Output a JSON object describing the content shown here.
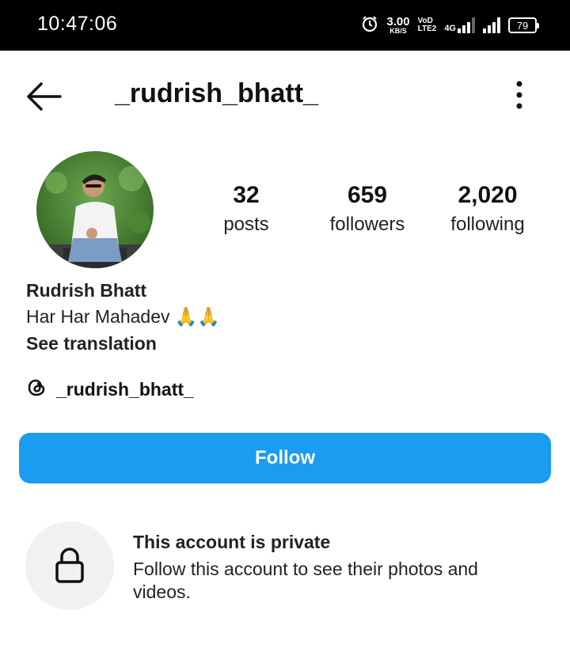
{
  "status_bar": {
    "time": "10:47:06",
    "speed_value": "3.00",
    "speed_unit": "KB/S",
    "volte_top": "VoD",
    "volte_bottom": "LTE2",
    "network": "4G",
    "battery": "79"
  },
  "header": {
    "username": "_rudrish_bhatt_",
    "back_icon": "arrow-left-icon",
    "more_icon": "vertical-dots-icon"
  },
  "stats": [
    {
      "value": "32",
      "label": "posts"
    },
    {
      "value": "659",
      "label": "followers"
    },
    {
      "value": "2,020",
      "label": "following"
    }
  ],
  "bio": {
    "name": "Rudrish Bhatt",
    "text": "Har Har Mahadev",
    "emoji": "🙏🙏",
    "see_translation": "See translation"
  },
  "threads": {
    "handle": "_rudrish_bhatt_",
    "icon": "threads-icon"
  },
  "follow_button": {
    "label": "Follow",
    "color": "#1a9cf0"
  },
  "private_notice": {
    "title": "This account is private",
    "description": "Follow this account to see their photos and videos.",
    "icon": "lock-icon"
  }
}
